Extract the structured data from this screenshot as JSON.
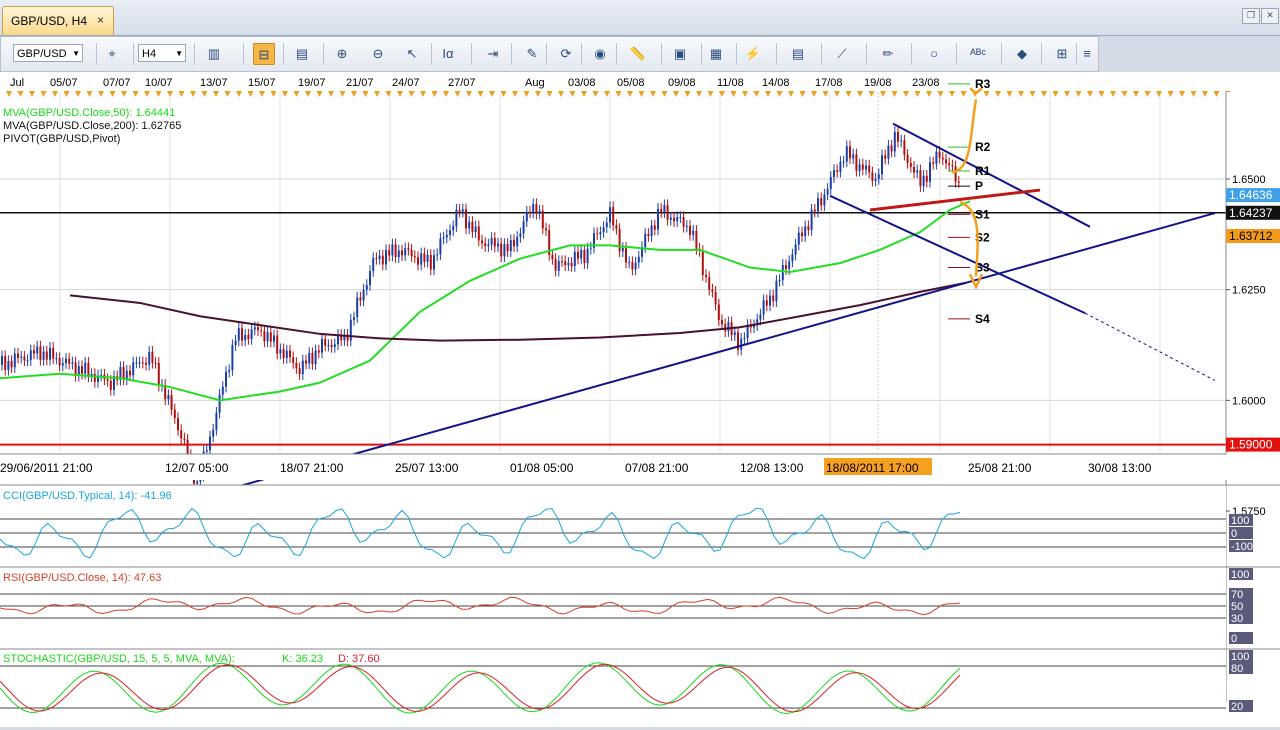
{
  "window": {
    "tab_title": "GBP/USD, H4",
    "close_glyph": "×",
    "restore_glyph": "❐",
    "close_window_glyph": "✕"
  },
  "toolbar": {
    "symbol_value": "GBP/USD",
    "timeframe_value": "H4",
    "buttons": [
      {
        "name": "chart-type-icon",
        "glyph": "▥"
      },
      {
        "name": "crosshair-icon",
        "glyph": "⌖"
      },
      {
        "name": "period-separator-icon",
        "glyph": "⊟",
        "active": true
      },
      {
        "name": "data-window-icon",
        "glyph": "▤"
      },
      {
        "name": "zoom-in-icon",
        "glyph": "⊕"
      },
      {
        "name": "zoom-out-icon",
        "glyph": "⊖"
      },
      {
        "name": "pointer-icon",
        "glyph": "↖"
      },
      {
        "name": "text-icon",
        "glyph": "Iα"
      },
      {
        "name": "scroll-icon",
        "glyph": "⇥"
      },
      {
        "name": "edit-icon",
        "glyph": "✎"
      },
      {
        "name": "refresh-icon",
        "glyph": "⟳"
      },
      {
        "name": "globe-icon",
        "glyph": "◉"
      },
      {
        "name": "ruler-icon",
        "glyph": "📏"
      },
      {
        "name": "image-icon",
        "glyph": "▣"
      },
      {
        "name": "template-icon",
        "glyph": "▦"
      },
      {
        "name": "indicator-icon",
        "glyph": "⚡"
      },
      {
        "name": "layers-icon",
        "glyph": "▤"
      },
      {
        "name": "trendline-icon",
        "glyph": "⟋"
      },
      {
        "name": "pencil-icon",
        "glyph": "✏"
      },
      {
        "name": "ellipse-icon",
        "glyph": "○"
      },
      {
        "name": "spellcheck-icon",
        "glyph": "ᴬᴮᶜ"
      },
      {
        "name": "eraser-icon",
        "glyph": "◆"
      },
      {
        "name": "hierarchy-icon",
        "glyph": "⊞"
      }
    ],
    "overflow_glyph": "≡"
  },
  "chart": {
    "month_labels": [
      "Jul",
      "05/07",
      "07/07",
      "10/07",
      "13/07",
      "15/07",
      "19/07",
      "21/07",
      "24/07",
      "27/07",
      "Aug",
      "03/08",
      "05/08",
      "09/08",
      "11/08",
      "14/08",
      "17/08",
      "19/08",
      "23/08"
    ],
    "date_axis_labels": [
      "29/06/2011 21:00",
      "12/07 05:00",
      "18/07 21:00",
      "25/07 13:00",
      "01/08 05:00",
      "07/08 21:00",
      "12/08 13:00",
      "18/08/2011 17:00",
      "25/08 21:00",
      "30/08 13:00"
    ],
    "price_ticks": [
      "1.6500",
      "1.6250",
      "1.6000",
      "1.5750"
    ],
    "price_badges": {
      "bid": "1.64636",
      "current": "1.64237",
      "mva200": "1.63712",
      "support": "1.59000"
    },
    "legend": [
      {
        "text": "MVA(GBP/USD.Close,50): 1.64441",
        "color": "#1bd81b"
      },
      {
        "text": "MVA(GBP/USD.Close,200): 1.62765",
        "color": "#111111"
      },
      {
        "text": "PIVOT(GBP/USD,Pivot)",
        "color": "#111111"
      }
    ],
    "pivot_labels": [
      "R3",
      "R2",
      "R1",
      "P",
      "S1",
      "S2",
      "S3",
      "S4"
    ]
  },
  "indicators": {
    "cci": {
      "label": "CCI(GBP/USD.Typical, 14): -41.96",
      "color": "#1aa6e0",
      "ticks": [
        "100",
        "0",
        "-100"
      ]
    },
    "rsi": {
      "label": "RSI(GBP/USD.Close, 14): 47.63",
      "color": "#d8402a",
      "ticks": [
        "100",
        "70",
        "50",
        "30",
        "0"
      ]
    },
    "stoch": {
      "label": "STOCHASTIC(GBP/USD, 15, 5, 5, MVA, MVA):",
      "k_label": "K: 36.23",
      "d_label": "D: 37.60",
      "color": "#1bd81b",
      "d_color": "#d8202a",
      "ticks": [
        "100",
        "80",
        "20"
      ]
    }
  },
  "colors": {
    "ma50": "#22dd22",
    "ma200": "#4a1030",
    "trend": "#14148a",
    "support_line": "#e31010",
    "candle_up": "#1a3fa8",
    "candle_down": "#b01010",
    "arrow": "#f5a01a",
    "highlight_date": "#f6a022"
  }
}
